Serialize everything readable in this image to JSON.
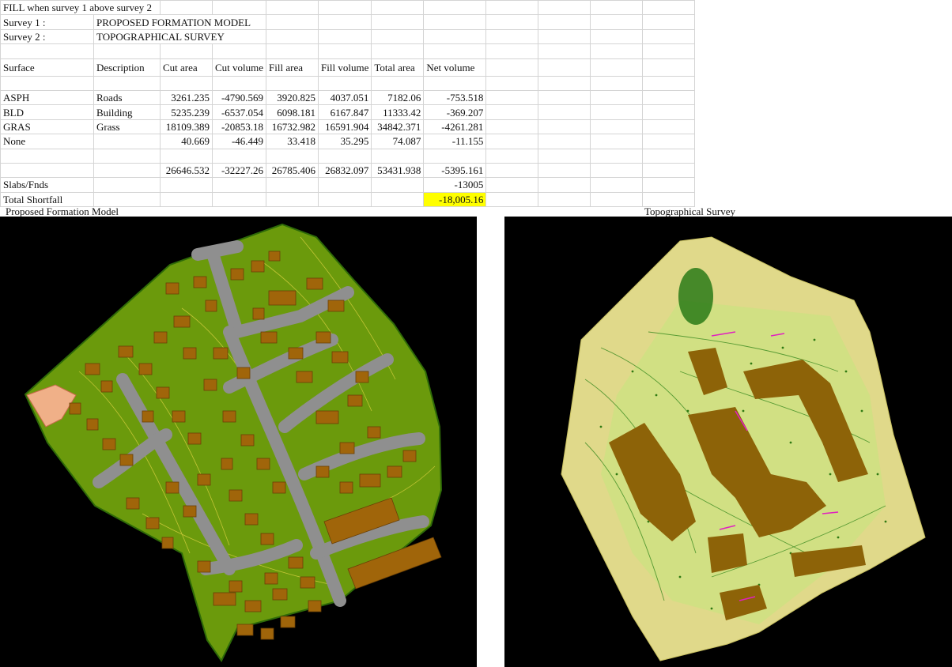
{
  "sheet": {
    "title": "FILL when survey 1 above survey 2",
    "survey1_label": "Survey 1 :",
    "survey1_value": "PROPOSED FORMATION MODEL",
    "survey2_label": "Survey 2 :",
    "survey2_value": "TOPOGRAPHICAL SURVEY",
    "headers": [
      "Surface",
      "Description",
      "Cut area",
      "Cut volume",
      "Fill area",
      "Fill volume",
      "Total area",
      "Net volume"
    ],
    "rows": [
      {
        "surface": "ASPH",
        "description": "Roads",
        "cut_area": "3261.235",
        "cut_volume": "-4790.569",
        "fill_area": "3920.825",
        "fill_volume": "4037.051",
        "total_area": "7182.06",
        "net_volume": "-753.518"
      },
      {
        "surface": "BLD",
        "description": "Building",
        "cut_area": "5235.239",
        "cut_volume": "-6537.054",
        "fill_area": "6098.181",
        "fill_volume": "6167.847",
        "total_area": "11333.42",
        "net_volume": "-369.207"
      },
      {
        "surface": "GRAS",
        "description": "Grass",
        "cut_area": "18109.389",
        "cut_volume": "-20853.18",
        "fill_area": "16732.982",
        "fill_volume": "16591.904",
        "total_area": "34842.371",
        "net_volume": "-4261.281"
      },
      {
        "surface": "None",
        "description": "",
        "cut_area": "40.669",
        "cut_volume": "-46.449",
        "fill_area": "33.418",
        "fill_volume": "35.295",
        "total_area": "74.087",
        "net_volume": "-11.155"
      }
    ],
    "totals": {
      "cut_area": "26646.532",
      "cut_volume": "-32227.26",
      "fill_area": "26785.406",
      "fill_volume": "26832.097",
      "total_area": "53431.938",
      "net_volume": "-5395.161"
    },
    "slabs_label": "Slabs/Fnds",
    "slabs_value": "-13005",
    "shortfall_label": "Total Shortfall",
    "shortfall_value": "-18,005.16",
    "highlight_color": "#ffff00"
  },
  "captions": {
    "left": "Proposed Formation Model",
    "right": "Topographical Survey"
  },
  "colors": {
    "formation_fill": "#6b9a0c",
    "road": "#8f8f8f",
    "building": "#a0650a",
    "survey_fill": "#e0d98a",
    "survey_building": "#8d6308"
  }
}
